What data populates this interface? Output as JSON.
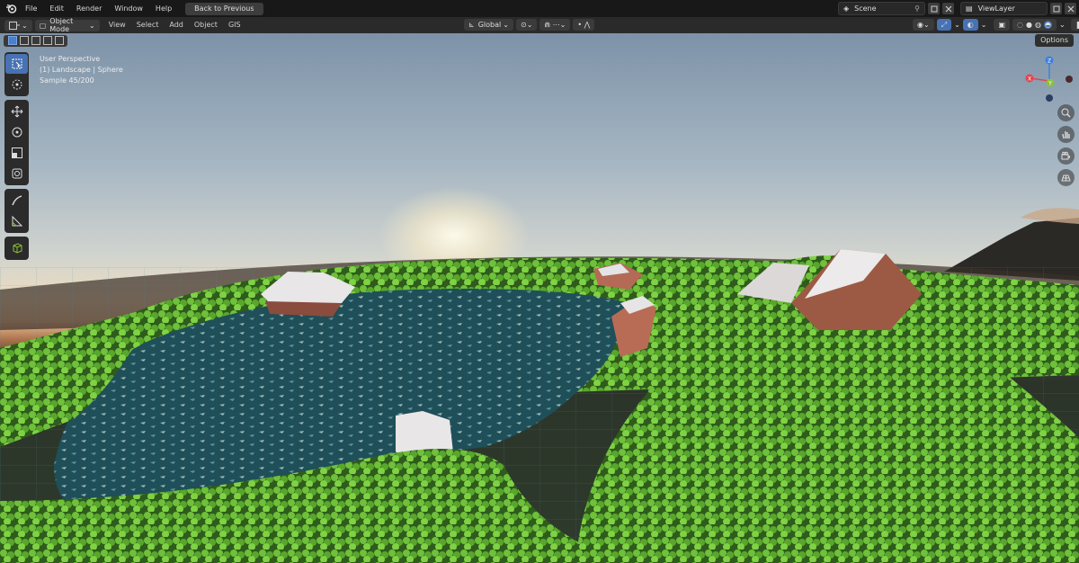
{
  "topbar": {
    "menus": [
      "File",
      "Edit",
      "Render",
      "Window",
      "Help"
    ],
    "back_button": "Back to Previous",
    "scene": "Scene",
    "view_layer": "ViewLayer"
  },
  "header": {
    "mode": "Object Mode",
    "menus": [
      "View",
      "Select",
      "Add",
      "Object",
      "GIS"
    ],
    "orientation": "Global"
  },
  "viewport": {
    "options_label": "Options",
    "perspective": "User Perspective",
    "object_info": "(1) Landscape | Sphere",
    "sample": "Sample 45/200"
  },
  "gizmo": {
    "x": "X",
    "y": "Y",
    "z": "Z",
    "colors": {
      "x": "#e0474f",
      "y": "#8ac13b",
      "z": "#3f7fe0"
    }
  },
  "colors": {
    "accent": "#4772b3"
  },
  "icons": [
    "blender-logo",
    "select-box-icon",
    "cursor-icon",
    "move-icon",
    "rotate-icon",
    "scale-icon",
    "transform-icon",
    "annotate-icon",
    "measure-icon",
    "add-cube-icon",
    "zoom-icon",
    "hand-icon",
    "camera-icon",
    "grid-icon"
  ]
}
